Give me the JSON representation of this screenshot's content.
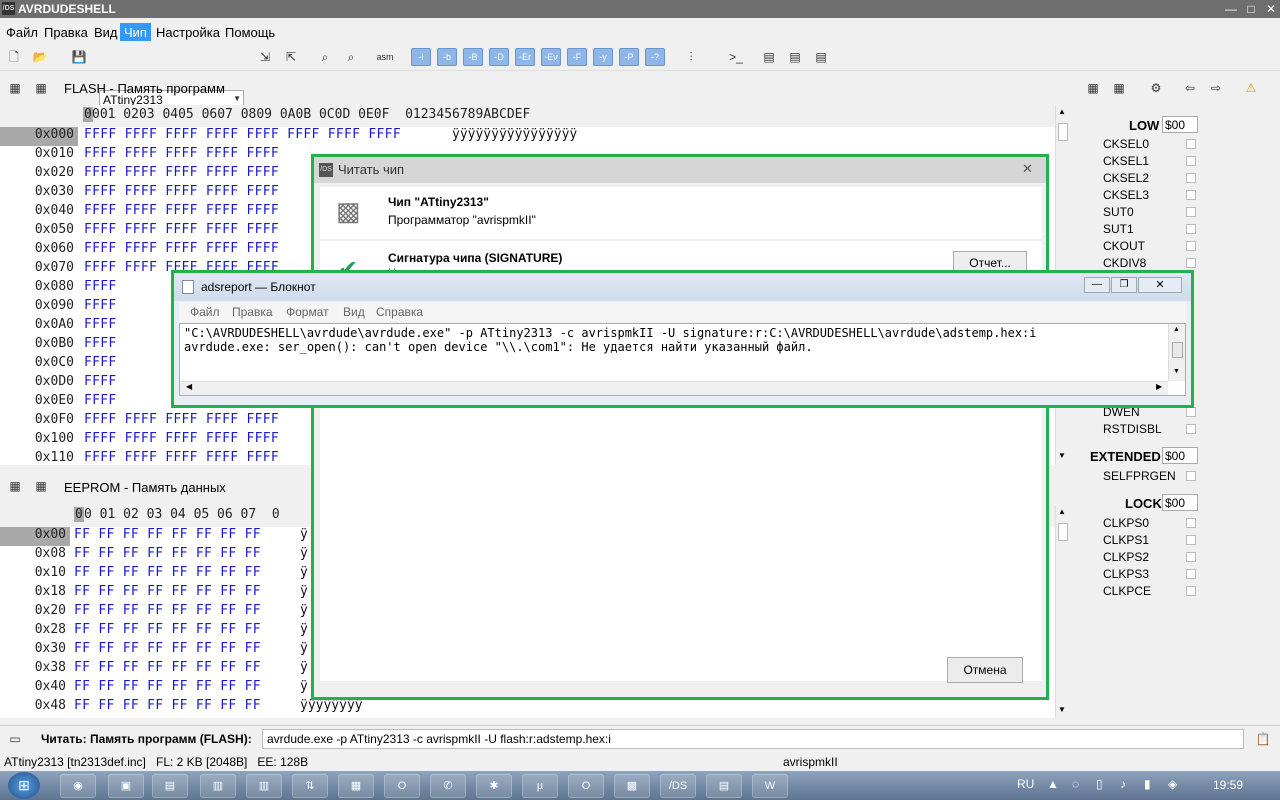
{
  "window": {
    "title": "AVRDUDESHELL",
    "app_icon": "/DS",
    "minimize": "—",
    "maximize": "□",
    "close": "✕"
  },
  "menu": [
    {
      "label": "Файл"
    },
    {
      "label": "Правка"
    },
    {
      "label": "Вид"
    },
    {
      "label": "Чип"
    },
    {
      "label": "Настройка"
    },
    {
      "label": "Помощь"
    }
  ],
  "toolbar": {
    "chip_value": "ATtiny2313",
    "fuse_buttons": [
      "-i",
      "-b",
      "-B",
      "-D",
      "-Er",
      "-Ev",
      "-F",
      "-y",
      "-P",
      "-?"
    ]
  },
  "flash": {
    "title": "FLASH - Память программ",
    "header_sel": "0",
    "header": "001 0203 0405 0607 0809 0A0B 0C0D 0E0F  0123456789ABCDEF",
    "rows": [
      {
        "addr": "0x000",
        "bytes": "FFFF FFFF FFFF FFFF FFFF FFFF FFFF FFFF",
        "ascii": "ÿÿÿÿÿÿÿÿÿÿÿÿÿÿÿÿ"
      },
      {
        "addr": "0x010",
        "bytes": "FFFF FFFF FFFF FFFF FFFF",
        "ascii": ""
      },
      {
        "addr": "0x020",
        "bytes": "FFFF FFFF FFFF FFFF FFFF",
        "ascii": ""
      },
      {
        "addr": "0x030",
        "bytes": "FFFF FFFF FFFF FFFF FFFF",
        "ascii": ""
      },
      {
        "addr": "0x040",
        "bytes": "FFFF FFFF FFFF FFFF FFFF",
        "ascii": ""
      },
      {
        "addr": "0x050",
        "bytes": "FFFF FFFF FFFF FFFF FFFF",
        "ascii": ""
      },
      {
        "addr": "0x060",
        "bytes": "FFFF FFFF FFFF FFFF FFFF",
        "ascii": ""
      },
      {
        "addr": "0x070",
        "bytes": "FFFF FFFF FFFF FFFF FFFF",
        "ascii": ""
      },
      {
        "addr": "0x080",
        "bytes": "FFFF",
        "ascii": ""
      },
      {
        "addr": "0x090",
        "bytes": "FFFF",
        "ascii": ""
      },
      {
        "addr": "0x0A0",
        "bytes": "FFFF",
        "ascii": ""
      },
      {
        "addr": "0x0B0",
        "bytes": "FFFF",
        "ascii": ""
      },
      {
        "addr": "0x0C0",
        "bytes": "FFFF",
        "ascii": ""
      },
      {
        "addr": "0x0D0",
        "bytes": "FFFF",
        "ascii": ""
      },
      {
        "addr": "0x0E0",
        "bytes": "FFFF",
        "ascii": ""
      },
      {
        "addr": "0x0F0",
        "bytes": "FFFF FFFF FFFF FFFF FFFF",
        "ascii": ""
      },
      {
        "addr": "0x100",
        "bytes": "FFFF FFFF FFFF FFFF FFFF",
        "ascii": ""
      },
      {
        "addr": "0x110",
        "bytes": "FFFF FFFF FFFF FFFF FFFF",
        "ascii": ""
      }
    ]
  },
  "eeprom": {
    "title": "EEPROM - Память данных",
    "header_sel": "0",
    "header": "0 01 02 03 04 05 06 07  0",
    "rows": [
      {
        "addr": "0x00",
        "bytes": "FF FF FF FF FF FF FF FF",
        "ascii": "ÿ"
      },
      {
        "addr": "0x08",
        "bytes": "FF FF FF FF FF FF FF FF",
        "ascii": "ÿ"
      },
      {
        "addr": "0x10",
        "bytes": "FF FF FF FF FF FF FF FF",
        "ascii": "ÿ"
      },
      {
        "addr": "0x18",
        "bytes": "FF FF FF FF FF FF FF FF",
        "ascii": "ÿ"
      },
      {
        "addr": "0x20",
        "bytes": "FF FF FF FF FF FF FF FF",
        "ascii": "ÿ"
      },
      {
        "addr": "0x28",
        "bytes": "FF FF FF FF FF FF FF FF",
        "ascii": "ÿ"
      },
      {
        "addr": "0x30",
        "bytes": "FF FF FF FF FF FF FF FF",
        "ascii": "ÿ"
      },
      {
        "addr": "0x38",
        "bytes": "FF FF FF FF FF FF FF FF",
        "ascii": "ÿ"
      },
      {
        "addr": "0x40",
        "bytes": "FF FF FF FF FF FF FF FF",
        "ascii": "ÿ"
      },
      {
        "addr": "0x48",
        "bytes": "FF FF FF FF FF FF FF FF",
        "ascii": "ÿÿÿÿÿÿÿÿ"
      }
    ]
  },
  "fuses": {
    "low": {
      "label": "LOW",
      "value": "$00",
      "bits": [
        "CKSEL0",
        "CKSEL1",
        "CKSEL2",
        "CKSEL3",
        "SUT0",
        "SUT1",
        "CKOUT",
        "CKDIV8"
      ]
    },
    "high": {
      "bits": [
        "DWEN",
        "RSTDISBL"
      ]
    },
    "extended": {
      "label": "EXTENDED",
      "value": "$00",
      "bits": [
        "SELFPRGEN"
      ]
    },
    "lock": {
      "label": "LOCK",
      "value": "$00",
      "bits": [
        "CLKPS0",
        "CLKPS1",
        "CLKPS2",
        "CLKPS3",
        "CLKPCE"
      ]
    }
  },
  "read_dialog": {
    "title": "Читать чип",
    "icon": "/DS",
    "chip_line": "Чип \"ATtiny2313\"",
    "programmer_line": "Программатор \"avrispmkII\"",
    "signature_title": "Сигнатура чипа (SIGNATURE)",
    "signature_sub": "Не удалось прочитать чип",
    "report_button": "Отчет...",
    "cancel_button": "Отмена",
    "close": "✕"
  },
  "notepad": {
    "title": "adsreport — Блокнот",
    "menu": [
      "Файл",
      "Правка",
      "Формат",
      "Вид",
      "Справка"
    ],
    "line1": "\"C:\\AVRDUDESHELL\\avrdude\\avrdude.exe\" -p ATtiny2313 -c avrispmkII -U signature:r:C:\\AVRDUDESHELL\\avrdude\\adstemp.hex:i",
    "line2": "avrdude.exe: ser_open(): can't open device \"\\\\.\\com1\": Не удается найти указанный файл."
  },
  "statusbar": {
    "read_label": "Читать: Память программ (FLASH):",
    "command": "avrdude.exe -p ATtiny2313 -c avrispmkII -U flash:r:adstemp.hex:i",
    "chip_info": "ATtiny2313 [tn2313def.inc]",
    "mem_info": "FL: 2 KB [2048B]   EE: 128B",
    "programmer": "avrispmkII"
  },
  "taskbar": {
    "lang": "RU",
    "time": "19:59"
  },
  "colors": {
    "accent_green": "#22b14c",
    "hex_blue": "#1a1acc",
    "menu_highlight": "#3399ff"
  }
}
